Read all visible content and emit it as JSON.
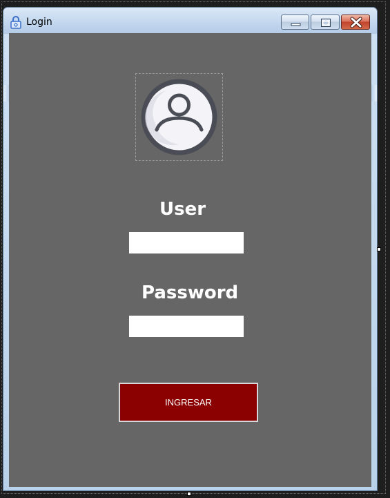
{
  "window": {
    "title": "Login",
    "icon": "lock-icon",
    "controls": {
      "minimize": "minimize-icon",
      "maximize": "maximize-icon",
      "close": "close-icon"
    }
  },
  "form": {
    "avatar_icon": "user-avatar-icon",
    "user_label": "User",
    "user_value": "",
    "password_label": "Password",
    "password_value": "",
    "submit_label": "INGRESAR"
  },
  "colors": {
    "client_background": "#666666",
    "submit_background": "#8b0000",
    "label_text": "#ffffff"
  }
}
